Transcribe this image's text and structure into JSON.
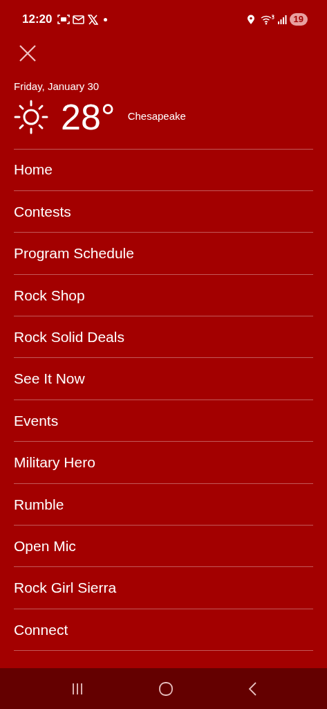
{
  "status_bar": {
    "time": "12:20",
    "battery": "19"
  },
  "weather": {
    "date": "Friday, January 30",
    "temperature": "28°",
    "city": "Chesapeake"
  },
  "menu": [
    {
      "label": "Home"
    },
    {
      "label": "Contests"
    },
    {
      "label": "Program Schedule"
    },
    {
      "label": "Rock Shop"
    },
    {
      "label": "Rock Solid Deals"
    },
    {
      "label": "See It Now"
    },
    {
      "label": "Events"
    },
    {
      "label": "Military Hero"
    },
    {
      "label": "Rumble"
    },
    {
      "label": "Open Mic"
    },
    {
      "label": "Rock Girl Sierra"
    },
    {
      "label": "Connect"
    }
  ]
}
